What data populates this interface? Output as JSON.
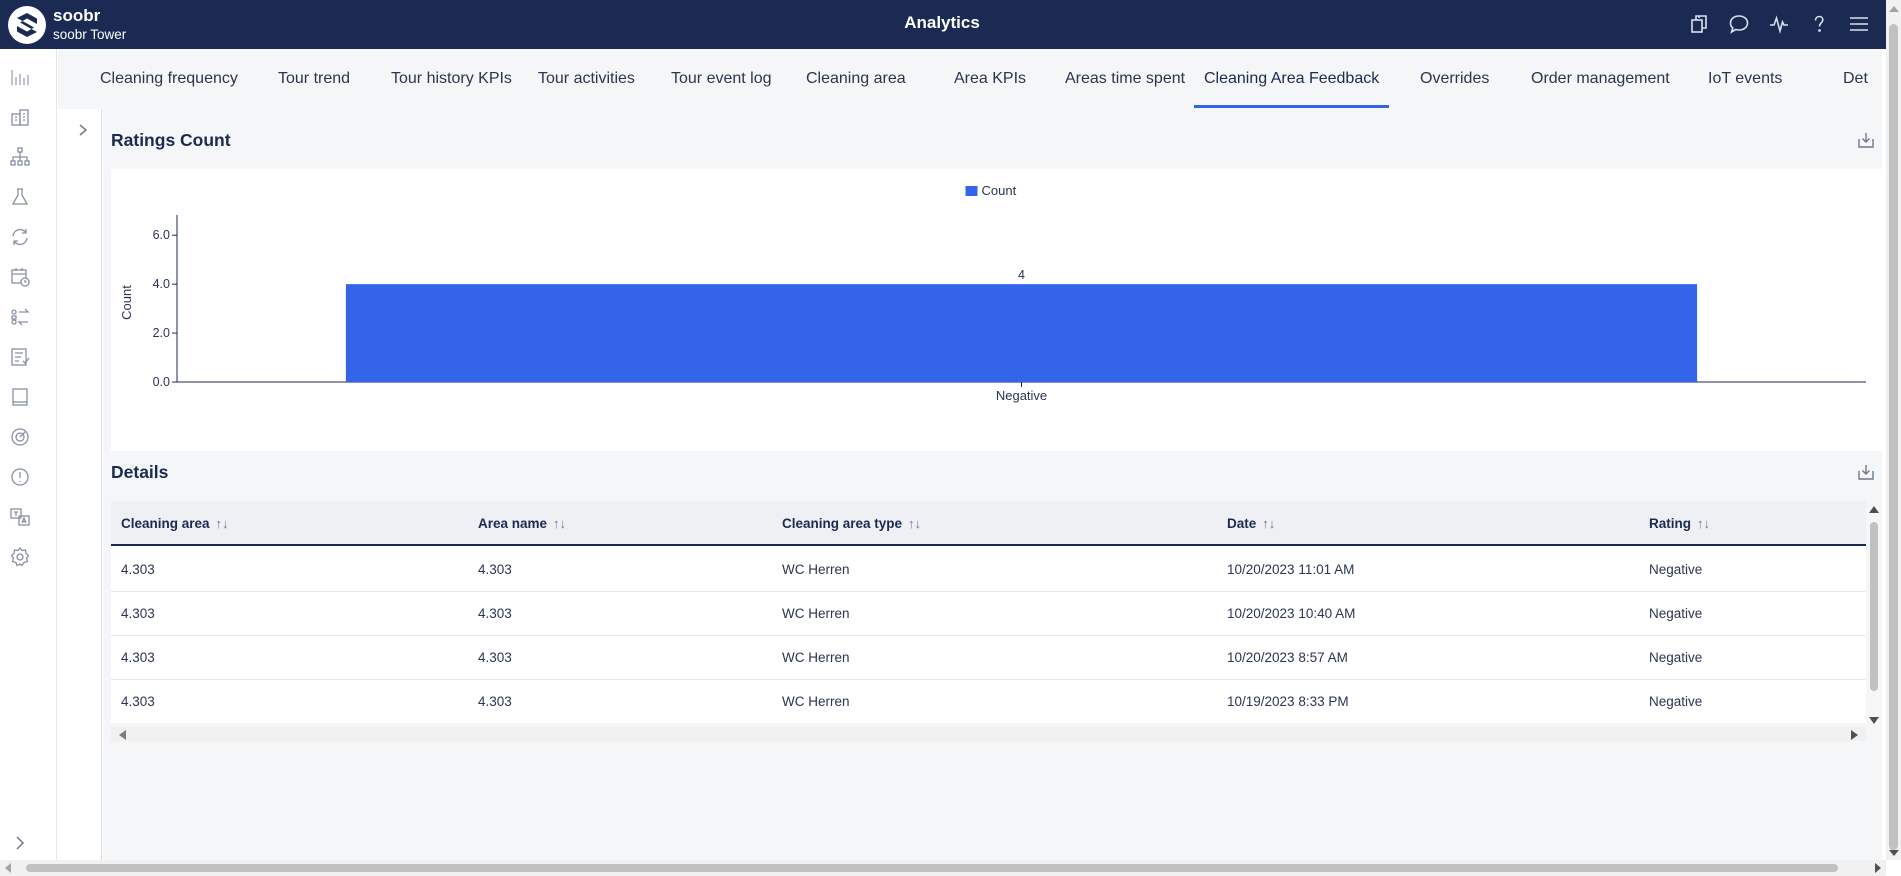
{
  "header": {
    "brand_name": "soobr",
    "brand_sub": "soobr Tower",
    "title": "Analytics",
    "icons": [
      "copy-icon",
      "chat-icon",
      "activity-icon",
      "help-icon",
      "menu-icon"
    ]
  },
  "rail": {
    "icons": [
      "analytics-icon",
      "building-icon",
      "hierarchy-icon",
      "lab-icon",
      "sync-icon",
      "calendar-clock-icon",
      "transfer-icon",
      "checklist-icon",
      "tablet-icon",
      "target-icon",
      "alert-icon",
      "translate-icon",
      "settings-icon"
    ],
    "expand_icon": "chevron-right-icon"
  },
  "tabs": [
    {
      "label": "Cleaning frequency",
      "active": false
    },
    {
      "label": "Tour trend",
      "active": false
    },
    {
      "label": "Tour history KPIs",
      "active": false
    },
    {
      "label": "Tour activities",
      "active": false
    },
    {
      "label": "Tour event log",
      "active": false
    },
    {
      "label": "Cleaning area",
      "active": false
    },
    {
      "label": "Area KPIs",
      "active": false
    },
    {
      "label": "Areas time spent",
      "active": false
    },
    {
      "label": "Cleaning Area Feedback",
      "active": true
    },
    {
      "label": "Overrides",
      "active": false
    },
    {
      "label": "Order management",
      "active": false
    },
    {
      "label": "IoT events",
      "active": false
    },
    {
      "label": "Det",
      "active": false
    }
  ],
  "ratings": {
    "title": "Ratings Count"
  },
  "chart_data": {
    "type": "bar",
    "title": "",
    "categories": [
      "Negative"
    ],
    "series": [
      {
        "name": "Count",
        "values": [
          4
        ]
      }
    ],
    "data_labels": [
      "4"
    ],
    "xlabel": "",
    "ylabel": "Count",
    "ylim": [
      0,
      6.5
    ],
    "yticks": [
      "0.0",
      "2.0",
      "4.0",
      "6.0"
    ],
    "legend": "top-center",
    "grid": false,
    "color": "#3464ea"
  },
  "details": {
    "title": "Details",
    "columns": [
      "Cleaning area",
      "Area name",
      "Cleaning area type",
      "Date",
      "Rating"
    ],
    "sort_icon": "↑↓",
    "rows": [
      [
        "4.303",
        "4.303",
        "WC Herren",
        "10/20/2023 11:01 AM",
        "Negative"
      ],
      [
        "4.303",
        "4.303",
        "WC Herren",
        "10/20/2023 10:40 AM",
        "Negative"
      ],
      [
        "4.303",
        "4.303",
        "WC Herren",
        "10/20/2023 8:57 AM",
        "Negative"
      ],
      [
        "4.303",
        "4.303",
        "WC Herren",
        "10/19/2023 8:33 PM",
        "Negative"
      ]
    ]
  },
  "colors": {
    "header_bg": "#1b2a52",
    "accent": "#3464ea",
    "panel_bg": "#f5f6f8"
  }
}
